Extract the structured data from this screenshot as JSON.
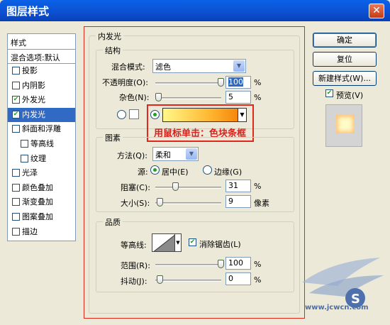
{
  "window": {
    "title": "图层样式",
    "close_glyph": "✕"
  },
  "style_list": {
    "header": "样式",
    "default": "混合选项:默认",
    "items": [
      {
        "label": "投影",
        "checked": false,
        "sub": false,
        "selected": false
      },
      {
        "label": "内阴影",
        "checked": false,
        "sub": false,
        "selected": false
      },
      {
        "label": "外发光",
        "checked": true,
        "sub": false,
        "selected": false
      },
      {
        "label": "内发光",
        "checked": true,
        "sub": false,
        "selected": true
      },
      {
        "label": "斜面和浮雕",
        "checked": false,
        "sub": false,
        "selected": false
      },
      {
        "label": "等高线",
        "checked": false,
        "sub": true,
        "selected": false
      },
      {
        "label": "纹理",
        "checked": false,
        "sub": true,
        "selected": false
      },
      {
        "label": "光泽",
        "checked": false,
        "sub": false,
        "selected": false
      },
      {
        "label": "颜色叠加",
        "checked": false,
        "sub": false,
        "selected": false
      },
      {
        "label": "渐变叠加",
        "checked": false,
        "sub": false,
        "selected": false
      },
      {
        "label": "图案叠加",
        "checked": false,
        "sub": false,
        "selected": false
      },
      {
        "label": "描边",
        "checked": false,
        "sub": false,
        "selected": false
      }
    ]
  },
  "panel": {
    "title": "内发光",
    "structure": {
      "title": "结构",
      "blend_mode_label": "混合模式:",
      "blend_mode_value": "滤色",
      "opacity_label": "不透明度(O):",
      "opacity_value": "100",
      "opacity_unit": "%",
      "opacity_level": 1.0,
      "noise_label": "杂色(N):",
      "noise_value": "5",
      "noise_unit": "%",
      "noise_level": 0.05
    },
    "annotation": "用鼠标单击：色块条框",
    "elements": {
      "title": "图素",
      "method_label": "方法(Q):",
      "method_value": "柔和",
      "source_label": "源:",
      "source_center": "居中(E)",
      "source_edge": "边缘(G)",
      "choke_label": "阻塞(C):",
      "choke_value": "31",
      "choke_unit": "%",
      "choke_level": 0.31,
      "size_label": "大小(S):",
      "size_value": "9",
      "size_unit": "像素"
    },
    "quality": {
      "title": "品质",
      "contour_label": "等高线:",
      "antialias_label": "消除锯齿(L)",
      "range_label": "范围(R):",
      "range_value": "100",
      "range_unit": "%",
      "range_level": 1.0,
      "jitter_label": "抖动(J):",
      "jitter_value": "0",
      "jitter_unit": "%"
    }
  },
  "buttons": {
    "ok": "确定",
    "reset": "复位",
    "new_style": "新建样式(W)...",
    "preview_label": "预览(V)"
  },
  "watermark": {
    "text": "www.jcwcn.com"
  },
  "colors": {
    "selection": "#316AC5",
    "annotation_red": "#E1261C",
    "check_green": "#21A121"
  }
}
